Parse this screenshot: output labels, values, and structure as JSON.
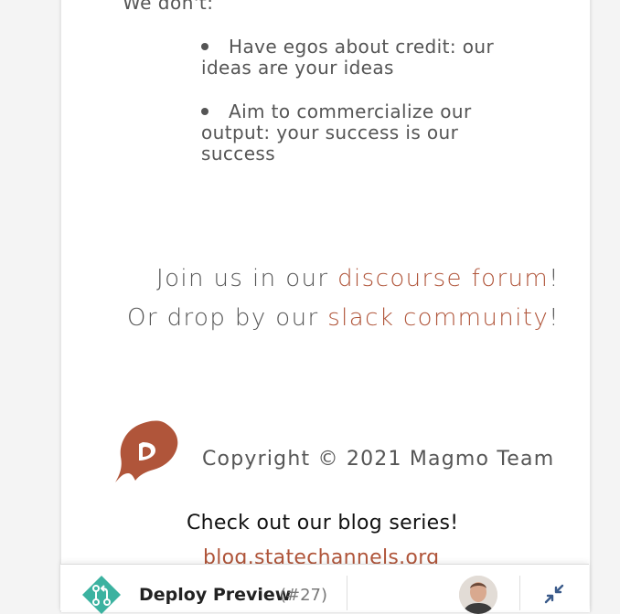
{
  "content": {
    "intro": "We don't:",
    "points": [
      "Have egos about credit: our ideas are your ideas",
      "Aim to commercialize our output: your success is our success"
    ],
    "join": {
      "line1_pre": "Join us in our ",
      "line1_link": "discourse forum",
      "line1_post": "!",
      "line2_pre": "Or drop by our ",
      "line2_link": "slack community",
      "line2_post": "!"
    },
    "copyright": "Copyright © 2021 Magmo Team",
    "blog_title": "Check out our blog series!",
    "blog_link": "blog.statechannels.org"
  },
  "deploy_bar": {
    "label": "Deploy Preview",
    "number": "(#27)"
  },
  "icons": {
    "logo": "magmo-flame-logo",
    "deploy": "git-pull-request-icon",
    "collapse": "collapse-arrows-icon"
  },
  "colors": {
    "accent": "#b0553a",
    "deploy_icon": "#3bb2a0"
  }
}
